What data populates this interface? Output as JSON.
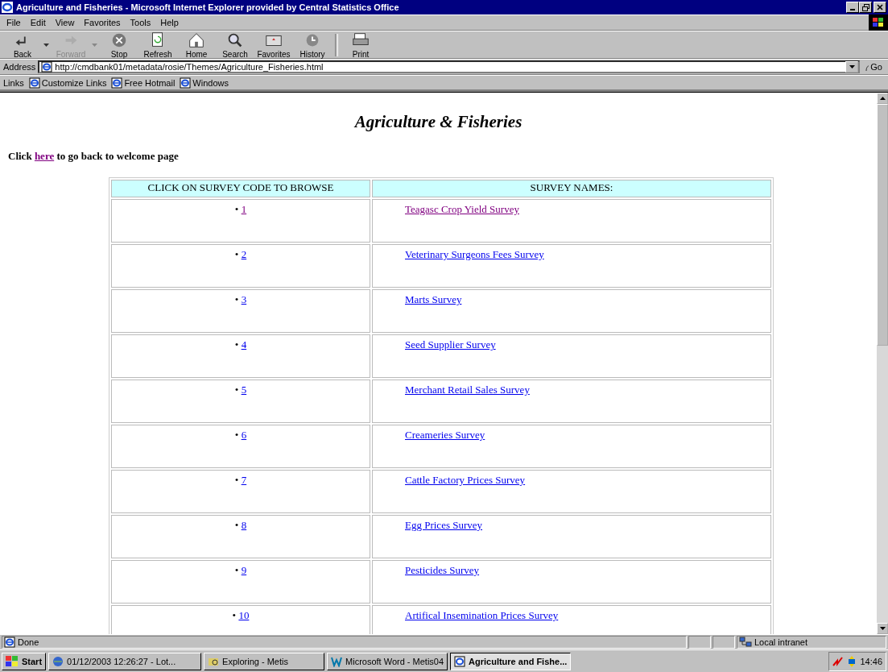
{
  "window": {
    "title": "Agriculture and Fisheries - Microsoft Internet Explorer provided by Central Statistics Office"
  },
  "menu": [
    {
      "label": "File"
    },
    {
      "label": "Edit"
    },
    {
      "label": "View"
    },
    {
      "label": "Favorites"
    },
    {
      "label": "Tools"
    },
    {
      "label": "Help"
    }
  ],
  "toolbar": [
    {
      "label": "Back",
      "disabled": false
    },
    {
      "label": "Forward",
      "disabled": true
    },
    {
      "label": "Stop",
      "disabled": false
    },
    {
      "label": "Refresh",
      "disabled": false
    },
    {
      "label": "Home",
      "disabled": false
    },
    {
      "label": "Search",
      "disabled": false
    },
    {
      "label": "Favorites",
      "disabled": false
    },
    {
      "label": "History",
      "disabled": false
    },
    {
      "label": "Print",
      "disabled": false
    }
  ],
  "address": {
    "label": "Address",
    "value": "http://cmdbank01/metadata/rosie/Themes/Agriculture_Fisheries.html",
    "go": "Go"
  },
  "links": {
    "label": "Links",
    "items": [
      "Customize Links",
      "Free Hotmail",
      "Windows"
    ]
  },
  "page": {
    "heading": "Agriculture & Fisheries",
    "intro_before": "Click",
    "intro_link": "here",
    "intro_link_visited": true,
    "intro_after": "to go back to welcome page",
    "table": {
      "columns": [
        "CLICK ON SURVEY CODE TO BROWSE",
        "SURVEY NAMES:"
      ],
      "rows": [
        {
          "bullet": "•",
          "code": "1",
          "name": "Teagasc Crop Yield Survey",
          "visited": true
        },
        {
          "bullet": "•",
          "code": "2",
          "name": "Veterinary Surgeons Fees Survey",
          "visited": false
        },
        {
          "bullet": "•",
          "code": "3",
          "name": "Marts Survey",
          "visited": false
        },
        {
          "bullet": "•",
          "code": "4",
          "name": "Seed Supplier Survey",
          "visited": false
        },
        {
          "bullet": "•",
          "code": "5",
          "name": "Merchant Retail Sales Survey",
          "visited": false
        },
        {
          "bullet": "•",
          "code": "6",
          "name": "Creameries Survey",
          "visited": false
        },
        {
          "bullet": "•",
          "code": "7",
          "name": "Cattle Factory Prices Survey",
          "visited": false
        },
        {
          "bullet": "•",
          "code": "8",
          "name": "Egg Prices Survey",
          "visited": false
        },
        {
          "bullet": "•",
          "code": "9",
          "name": "Pesticides Survey",
          "visited": false
        },
        {
          "bullet": "•",
          "code": "10",
          "name": "Artifical Insemination Prices Survey",
          "visited": false
        }
      ]
    }
  },
  "status_bar": {
    "text": "Done",
    "zone": "Local intranet"
  },
  "taskbar": {
    "start": "Start",
    "buttons": [
      {
        "label": "01/12/2003 12:26:27 - Lot...",
        "selected": false
      },
      {
        "label": "Exploring - Metis",
        "selected": false
      },
      {
        "label": "Microsoft Word - Metis04",
        "selected": false
      },
      {
        "label": "Agriculture and Fishe...",
        "selected": true
      }
    ],
    "clock": "14:46"
  }
}
